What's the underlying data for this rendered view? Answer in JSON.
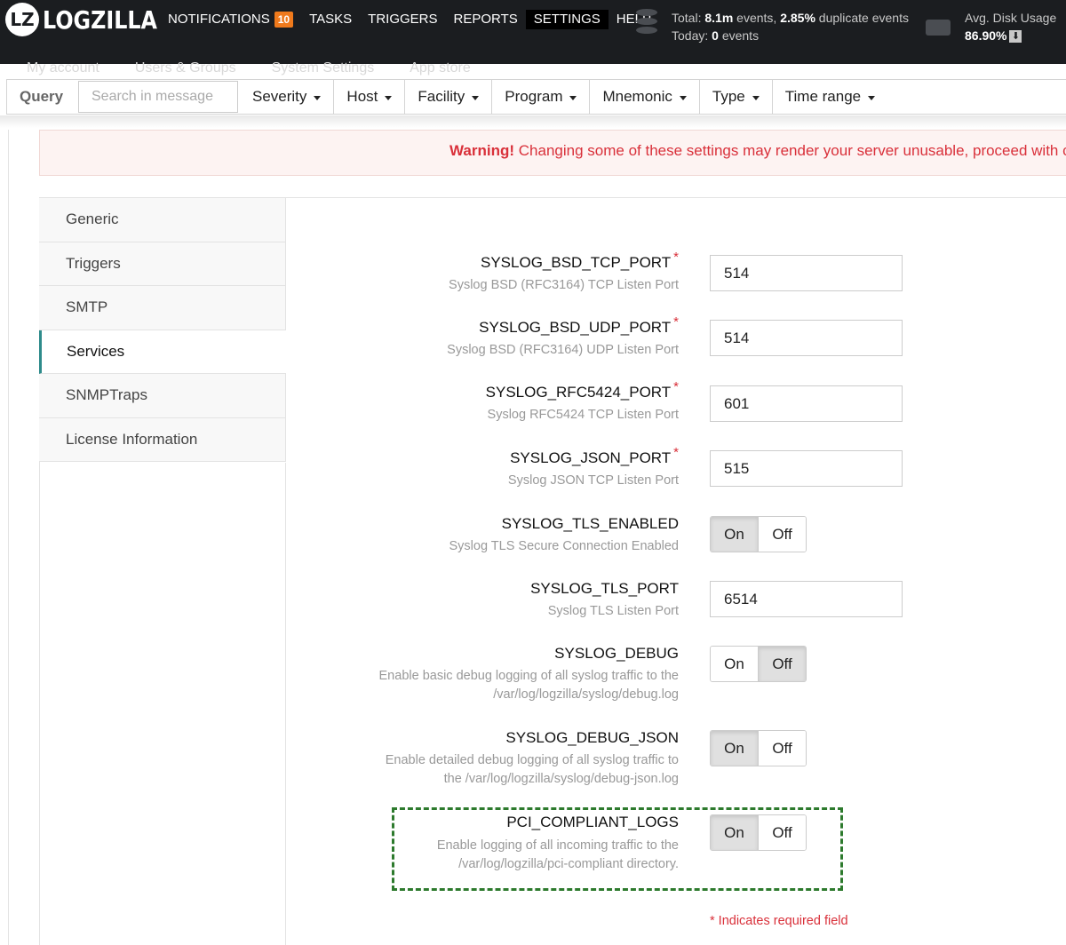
{
  "brand": {
    "logo_mark": "LZ",
    "name": "LOGZILLA"
  },
  "nav": {
    "items": [
      {
        "label": "NOTIFICATIONS",
        "badge": "10"
      },
      {
        "label": "TASKS"
      },
      {
        "label": "TRIGGERS"
      },
      {
        "label": "REPORTS"
      },
      {
        "label": "SETTINGS",
        "active": true
      },
      {
        "label": "HELP"
      }
    ]
  },
  "stats": {
    "total_prefix": "Total:",
    "total_events": "8.1m",
    "events_word": "events,",
    "duplicate_pct": "2.85%",
    "duplicate_suffix": "duplicate events",
    "today_prefix": "Today:",
    "today_events": "0",
    "today_suffix": "events"
  },
  "disk": {
    "label": "Avg. Disk Usage",
    "value": "86.90%"
  },
  "subnav": [
    "My account",
    "Users & Groups",
    "System Settings",
    "App store"
  ],
  "query": {
    "label": "Query",
    "search_placeholder": "Search in message",
    "filters": [
      "Severity",
      "Host",
      "Facility",
      "Program",
      "Mnemonic",
      "Type",
      "Time range"
    ]
  },
  "warning": {
    "strong": "Warning!",
    "text": "Changing some of these settings may render your server unusable, proceed with ca"
  },
  "sidemenu": [
    {
      "label": "Generic"
    },
    {
      "label": "Triggers"
    },
    {
      "label": "SMTP"
    },
    {
      "label": "Services",
      "active": true
    },
    {
      "label": "SNMPTraps"
    },
    {
      "label": "License Information"
    }
  ],
  "fields": {
    "bsd_tcp": {
      "name": "SYSLOG_BSD_TCP_PORT",
      "help": "Syslog BSD (RFC3164) TCP Listen Port",
      "value": "514"
    },
    "bsd_udp": {
      "name": "SYSLOG_BSD_UDP_PORT",
      "help": "Syslog BSD (RFC3164) UDP Listen Port",
      "value": "514"
    },
    "rfc5424": {
      "name": "SYSLOG_RFC5424_PORT",
      "help": "Syslog RFC5424 TCP Listen Port",
      "value": "601"
    },
    "json": {
      "name": "SYSLOG_JSON_PORT",
      "help": "Syslog JSON TCP Listen Port",
      "value": "515"
    },
    "tls_enabled": {
      "name": "SYSLOG_TLS_ENABLED",
      "help": "Syslog TLS Secure Connection Enabled",
      "on": "On",
      "off": "Off",
      "selected": "On"
    },
    "tls_port": {
      "name": "SYSLOG_TLS_PORT",
      "help": "Syslog TLS Listen Port",
      "value": "6514"
    },
    "debug": {
      "name": "SYSLOG_DEBUG",
      "help_1": "Enable basic debug logging of all syslog traffic to the",
      "help_2": "/var/log/logzilla/syslog/debug.log",
      "on": "On",
      "off": "Off",
      "selected": "Off"
    },
    "debug_json": {
      "name": "SYSLOG_DEBUG_JSON",
      "help_1": "Enable detailed debug logging of all syslog traffic to",
      "help_2": "the /var/log/logzilla/syslog/debug-json.log",
      "on": "On",
      "off": "Off",
      "selected": "On"
    },
    "pci": {
      "name": "PCI_COMPLIANT_LOGS",
      "help_1": "Enable logging of all incoming traffic to the",
      "help_2": "/var/log/logzilla/pci-compliant directory.",
      "on": "On",
      "off": "Off",
      "selected": "On"
    }
  },
  "required_marker": "*",
  "required_note": "* Indicates required field"
}
